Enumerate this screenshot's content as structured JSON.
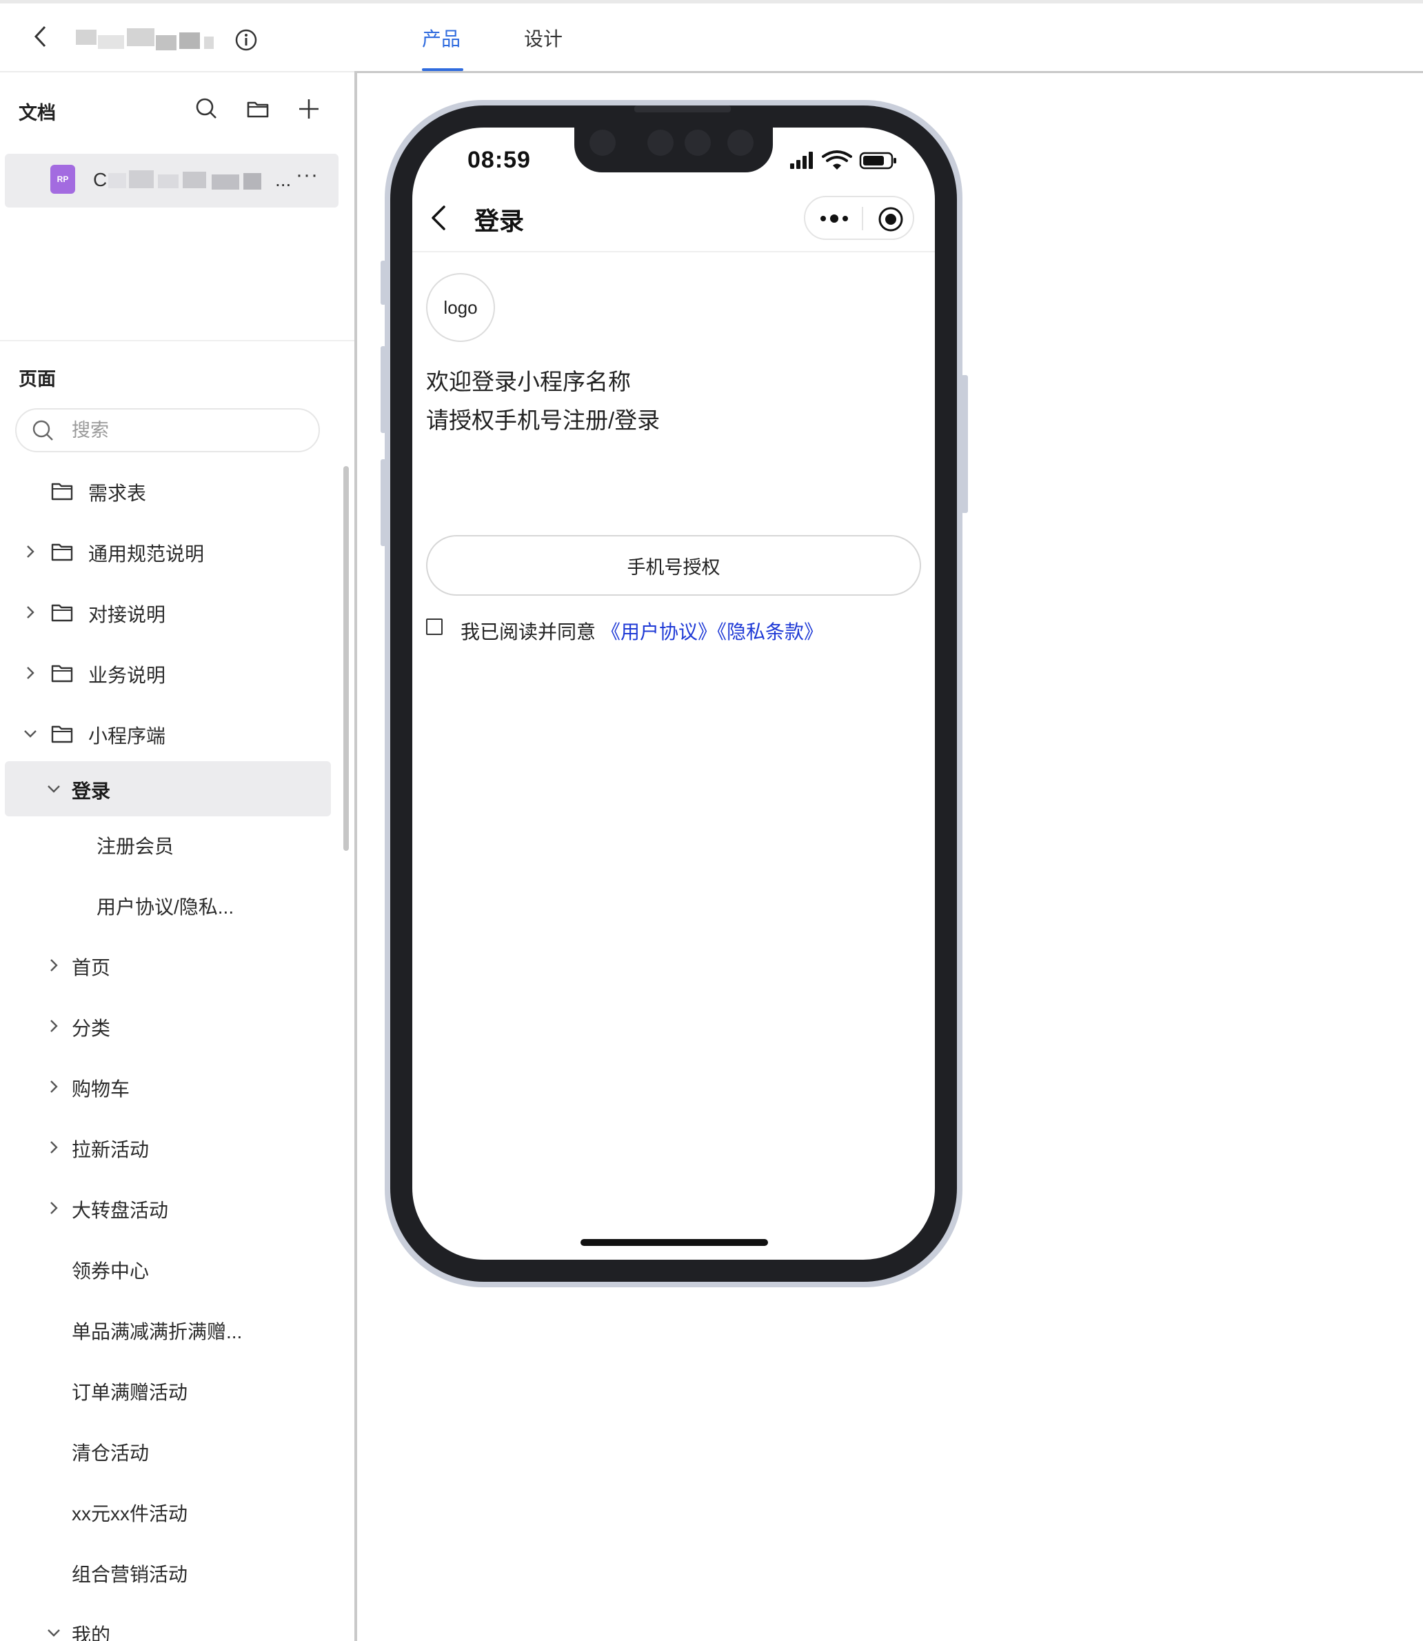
{
  "header": {
    "tabs": [
      {
        "label": "产品",
        "active": true
      },
      {
        "label": "设计",
        "active": false
      }
    ],
    "accent_color": "#2f6bde"
  },
  "sidebar": {
    "docs_title": "文档",
    "doc_item": {
      "badge": "RP",
      "name_start": "C",
      "name_end": "...",
      "more": "···",
      "badge_color": "#a36be0"
    },
    "pages_title": "页面",
    "search_placeholder": "搜索",
    "tree": [
      {
        "label": "需求表",
        "icon": "folder-icon",
        "expand": "none"
      },
      {
        "label": "通用规范说明",
        "icon": "folder-icon",
        "expand": "collapsed"
      },
      {
        "label": "对接说明",
        "icon": "folder-icon",
        "expand": "collapsed"
      },
      {
        "label": "业务说明",
        "icon": "folder-icon",
        "expand": "collapsed"
      },
      {
        "label": "小程序端",
        "icon": "folder-icon",
        "expand": "expanded"
      },
      {
        "label": "登录",
        "expand": "expanded",
        "selected": true
      },
      {
        "label": "注册会员",
        "expand": "none"
      },
      {
        "label": "用户协议/隐私...",
        "expand": "none"
      },
      {
        "label": "首页",
        "expand": "collapsed"
      },
      {
        "label": "分类",
        "expand": "collapsed"
      },
      {
        "label": "购物车",
        "expand": "collapsed"
      },
      {
        "label": "拉新活动",
        "expand": "collapsed"
      },
      {
        "label": "大转盘活动",
        "expand": "collapsed"
      },
      {
        "label": "领券中心",
        "expand": "none"
      },
      {
        "label": "单品满减满折满赠...",
        "expand": "none"
      },
      {
        "label": "订单满赠活动",
        "expand": "none"
      },
      {
        "label": "清仓活动",
        "expand": "none"
      },
      {
        "label": "xx元xx件活动",
        "expand": "none"
      },
      {
        "label": "组合营销活动",
        "expand": "none"
      },
      {
        "label": "我的",
        "expand": "expanded"
      }
    ]
  },
  "phone": {
    "status_time": "08:59",
    "nav_title": "登录",
    "logo_text": "logo",
    "welcome_line1": "欢迎登录小程序名称",
    "welcome_line2": "请授权手机号注册/登录",
    "auth_button": "手机号授权",
    "agree_text": "我已阅读并同意",
    "user_agreement": "《用户协议》",
    "privacy_policy": "《隐私条款》",
    "link_color": "#1f3ad6"
  }
}
